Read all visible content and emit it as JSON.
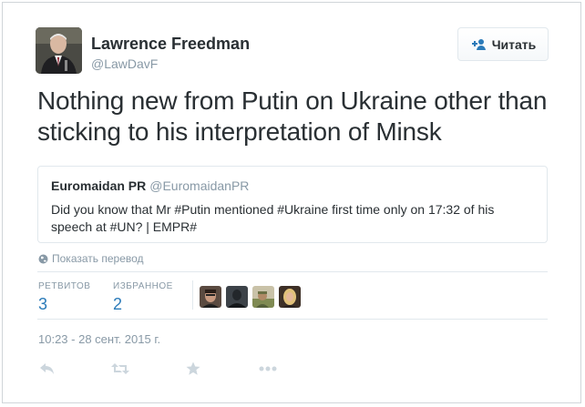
{
  "author": {
    "name": "Lawrence Freedman",
    "handle": "@LawDavF"
  },
  "follow_button": {
    "label": "Читать",
    "icon": "follow-user-icon"
  },
  "tweet_text": "Nothing new from Putin on Ukraine other than sticking to his interpretation of Minsk",
  "quoted_tweet": {
    "name": "Euromaidan PR",
    "handle": "@EuromaidanPR",
    "text": "Did you know that Mr #Putin mentioned #Ukraine first time only on 17:32 of his speech at #UN? | EMPR#"
  },
  "translate_link": {
    "label": "Показать перевод",
    "icon": "globe-icon"
  },
  "stats": {
    "retweets_label": "РЕТВИТОВ",
    "retweets_count": "3",
    "favorites_label": "ИЗБРАННОЕ",
    "favorites_count": "2"
  },
  "timestamp": "10:23 - 28 сент. 2015 г.",
  "actions": [
    "reply-icon",
    "retweet-icon",
    "favorite-icon",
    "more-icon"
  ],
  "colors": {
    "link_blue": "#2b7bb9",
    "muted_gray": "#8899a6",
    "text_dark": "#292f33",
    "border": "#e1e8ed"
  }
}
